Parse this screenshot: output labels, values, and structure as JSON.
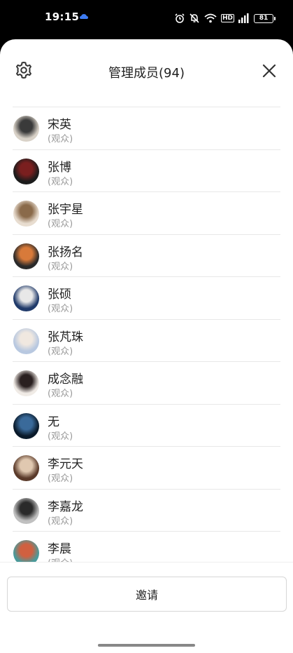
{
  "status_bar": {
    "time": "19:15",
    "battery": "81"
  },
  "header": {
    "title": "管理成员(94)",
    "settings_icon": "gear-icon",
    "close_icon": "close-icon"
  },
  "members": [
    {
      "name": "宋英",
      "role": "(观众)",
      "avatar_colors": [
        "#d9d2c8",
        "#3a3a3a"
      ]
    },
    {
      "name": "张博",
      "role": "(观众)",
      "avatar_colors": [
        "#1c1c1c",
        "#7a1f1f"
      ]
    },
    {
      "name": "张宇星",
      "role": "(观众)",
      "avatar_colors": [
        "#e8ddd0",
        "#8a6a4a"
      ]
    },
    {
      "name": "张扬名",
      "role": "(观众)",
      "avatar_colors": [
        "#2a2a2a",
        "#d87a3a"
      ]
    },
    {
      "name": "张硕",
      "role": "(观众)",
      "avatar_colors": [
        "#203a6a",
        "#e8e8e8"
      ]
    },
    {
      "name": "张芃珠",
      "role": "(观众)",
      "avatar_colors": [
        "#b8c8e0",
        "#f0e8e0"
      ]
    },
    {
      "name": "成念融",
      "role": "(观众)",
      "avatar_colors": [
        "#f0ebe6",
        "#2a2020"
      ]
    },
    {
      "name": "无",
      "role": "(观众)",
      "avatar_colors": [
        "#0a1a2a",
        "#3a6a9a"
      ]
    },
    {
      "name": "李元天",
      "role": "(观众)",
      "avatar_colors": [
        "#5a3a2a",
        "#e0c8b0"
      ]
    },
    {
      "name": "李嘉龙",
      "role": "(观众)",
      "avatar_colors": [
        "#c0c0c0",
        "#2a2a2a"
      ]
    },
    {
      "name": "李晨",
      "role": "(观众)",
      "avatar_colors": [
        "#4a9a9a",
        "#d06040"
      ]
    }
  ],
  "actions": {
    "invite_label": "邀请"
  }
}
